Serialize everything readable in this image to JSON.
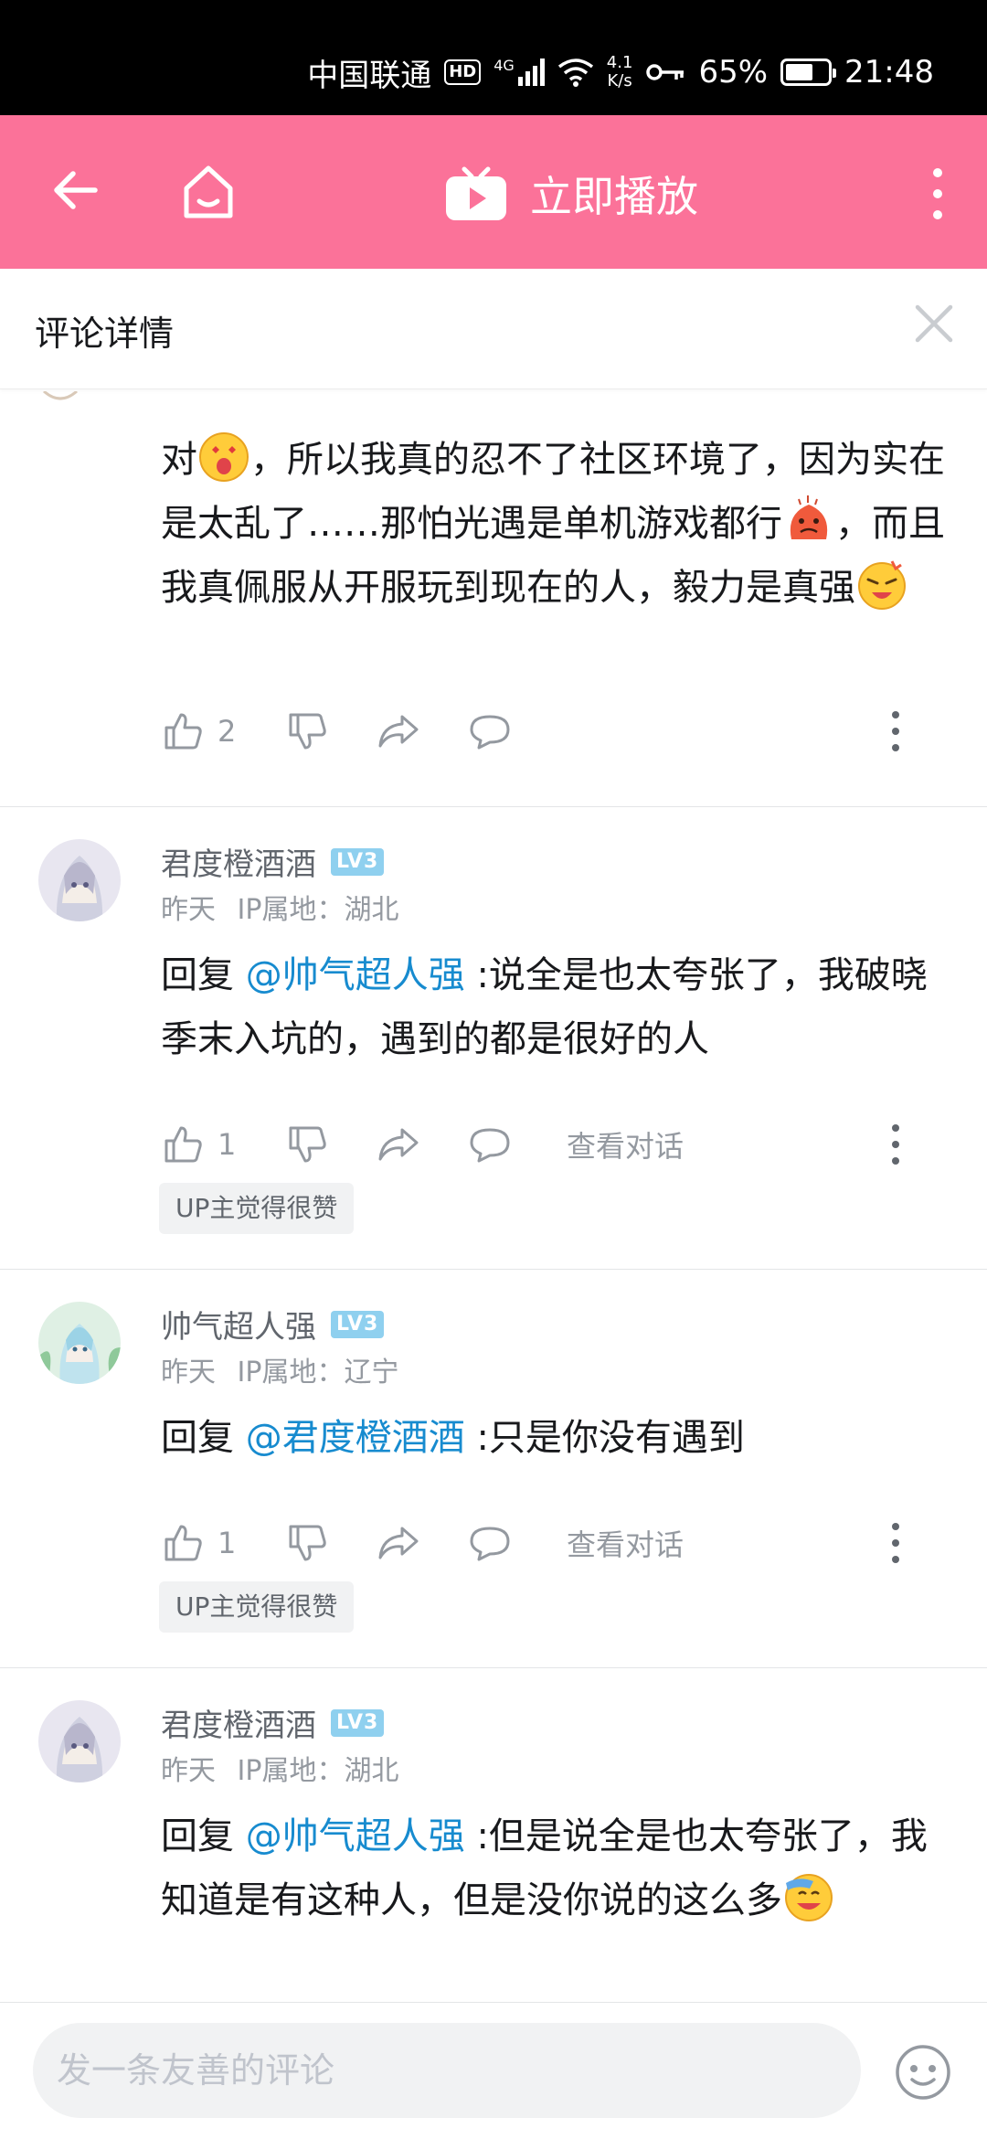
{
  "status_bar": {
    "carrier": "中国联通",
    "hd": "HD",
    "network": "4G",
    "speed_value": "4.1",
    "speed_unit": "K/s",
    "battery": "65%",
    "battery_level": 0.65,
    "time": "21:48"
  },
  "app_bar": {
    "play_label": "立即播放",
    "bg_color": "#fb7299"
  },
  "panel": {
    "title": "评论详情"
  },
  "first_comment": {
    "text_a": "对",
    "text_b": "，所以我真的忍不了社区环境了，因为实在是太乱了……那怕光遇是单机游戏都行",
    "text_c": "，而且我真佩服从开服玩到现在的人，毅力是真强",
    "emoji_1": "shocked-emoji",
    "emoji_2": "angry-blob-emoji",
    "emoji_3": "crying-yell-emoji",
    "likes": "2"
  },
  "replies": [
    {
      "username": "君度橙酒酒",
      "level": "LV3",
      "time": "昨天",
      "ip": "IP属地：湖北",
      "prefix": "回复",
      "mention": "@帅气超人强",
      "text": ":说全是也太夸张了，我破晓季末入坑的，遇到的都是很好的人",
      "likes": "1",
      "view_dialog": "查看对话",
      "up_badge": "UP主觉得很赞"
    },
    {
      "username": "帅气超人强",
      "level": "LV3",
      "time": "昨天",
      "ip": "IP属地：辽宁",
      "prefix": "回复",
      "mention": "@君度橙酒酒",
      "text": ":只是你没有遇到",
      "likes": "1",
      "view_dialog": "查看对话",
      "up_badge": "UP主觉得很赞"
    },
    {
      "username": "君度橙酒酒",
      "level": "LV3",
      "time": "昨天",
      "ip": "IP属地：湖北",
      "prefix": "回复",
      "mention": "@帅气超人强",
      "text": ":但是说全是也太夸张了，我知道是有这种人，但是没你说的这么多",
      "emoji": "laugh-cry-emoji"
    }
  ],
  "bottom_bar": {
    "placeholder": "发一条友善的评论"
  }
}
